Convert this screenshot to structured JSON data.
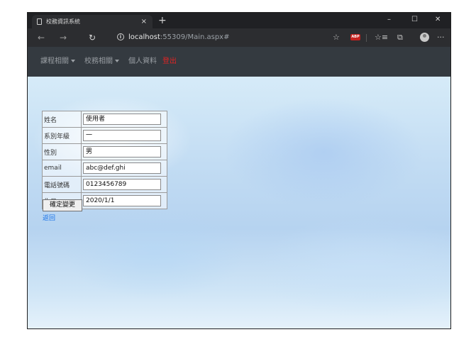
{
  "browser": {
    "tab_title": "校務資訊系統",
    "tab_close": "×",
    "new_tab": "+",
    "controls": {
      "minimize": "–",
      "maximize": "☐",
      "close": "✕"
    },
    "nav": {
      "back": "←",
      "forward": "→",
      "reload": "↻"
    },
    "url_host": "localhost",
    "url_rest": ":55309/Main.aspx#",
    "info_icon_label": "i",
    "abp_label": "ABP",
    "icons": {
      "favorite": "☆",
      "favorites_list": "☆≡",
      "collections": "⧉",
      "more": "···"
    }
  },
  "menu": {
    "items": [
      "課程相關",
      "校務相關",
      "個人資料"
    ],
    "logout": "登出"
  },
  "profile": {
    "rows": [
      {
        "label": "姓名",
        "value": "使用者"
      },
      {
        "label": "系別年級",
        "value": "一"
      },
      {
        "label": "性別",
        "value": "男"
      },
      {
        "label": "email",
        "value": "abc@def.ghi"
      },
      {
        "label": "電話號碼",
        "value": "0123456789"
      },
      {
        "label": "生日",
        "value": "2020/1/1"
      }
    ],
    "confirm_button": "確定變更",
    "back_link": "返回"
  },
  "colors": {
    "titlebar": "#202124",
    "addressbar": "#2c2d30",
    "menubar": "#343a40",
    "logout": "#e02424",
    "link": "#1a73e8"
  }
}
